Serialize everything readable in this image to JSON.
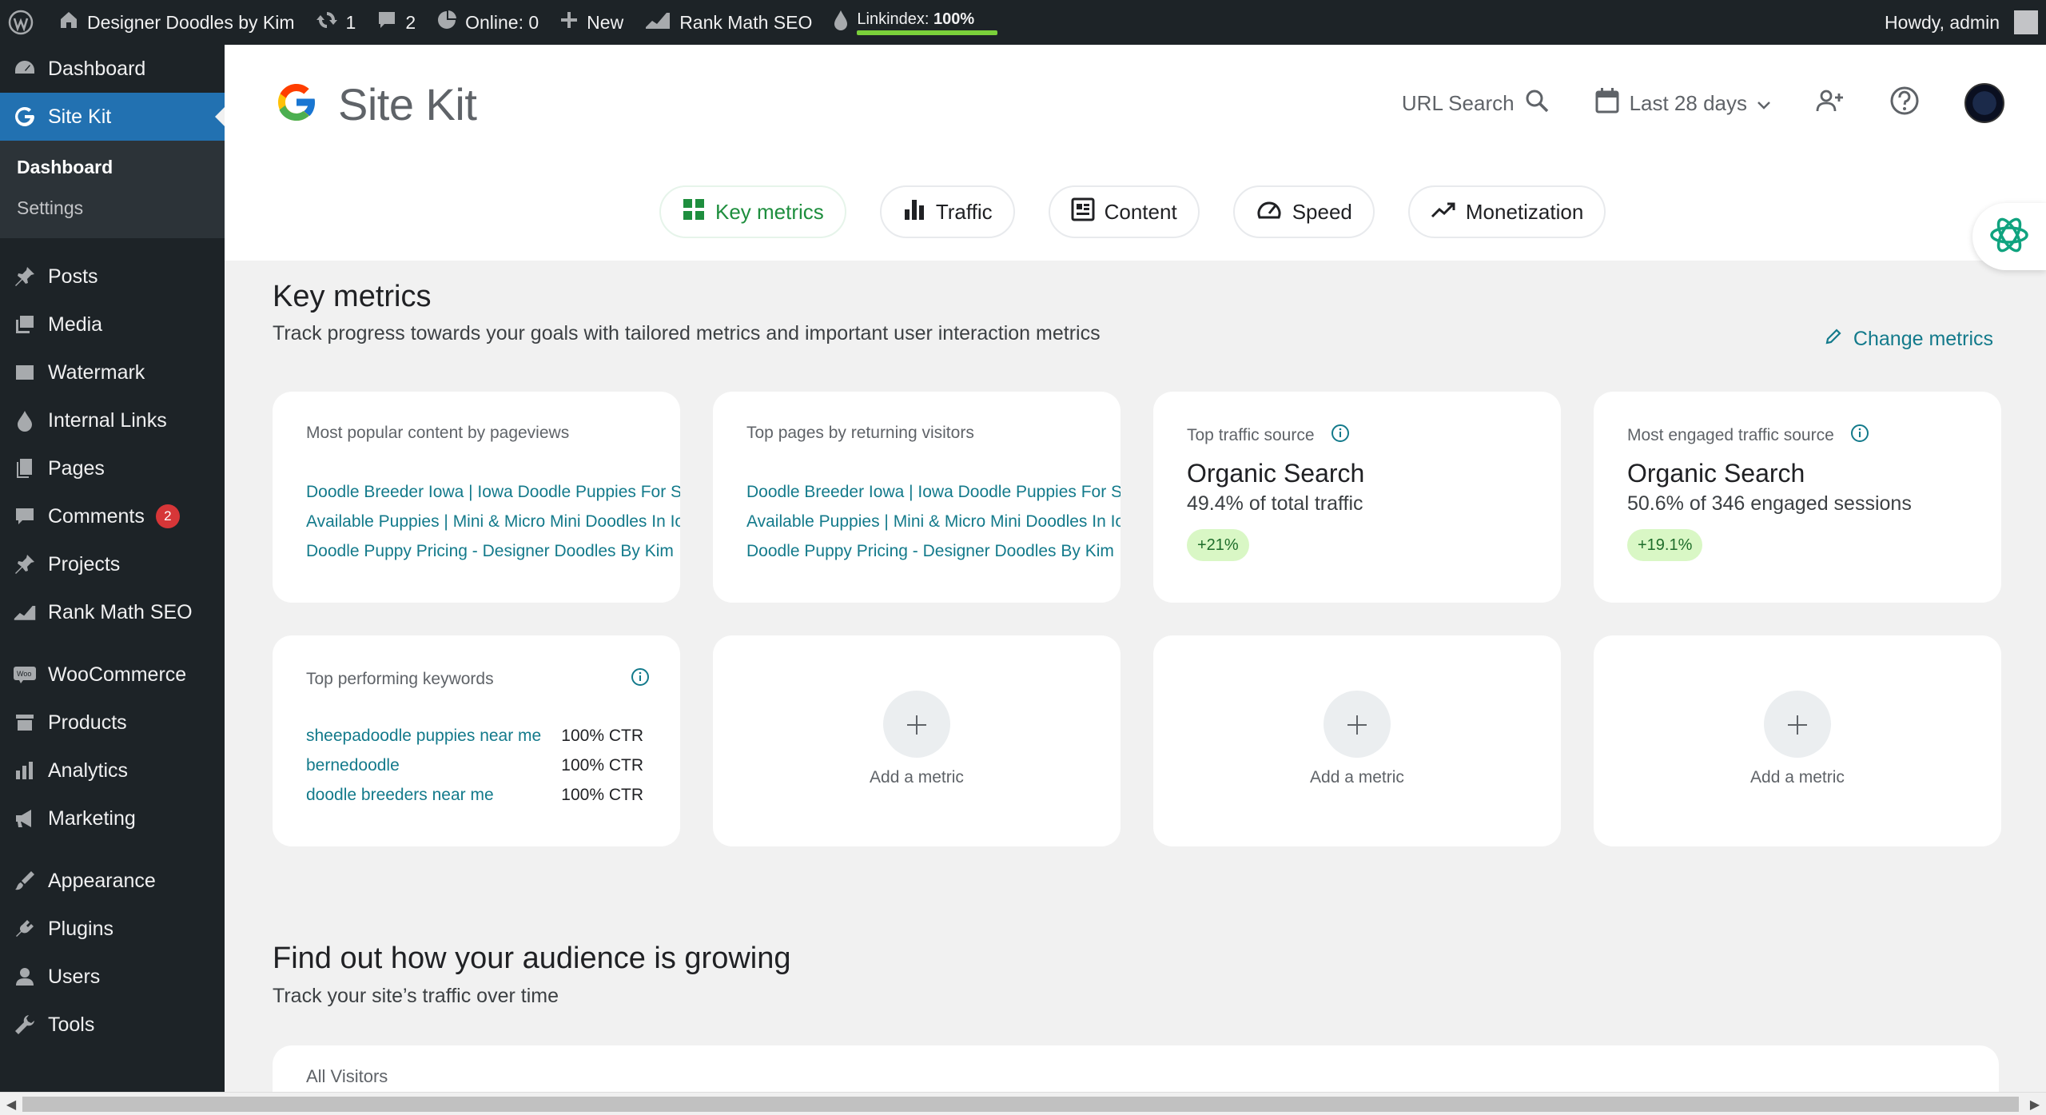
{
  "adminbar": {
    "site_name": "Designer Doodles by Kim",
    "updates_count": "1",
    "comments_count": "2",
    "online": "Online: 0",
    "new": "New",
    "rank_math": "Rank Math SEO",
    "linkindex_label": "Linkindex:",
    "linkindex_value": "100%",
    "linkindex_progress": 1.0,
    "howdy": "Howdy, admin"
  },
  "sidebar": {
    "dashboard": "Dashboard",
    "site_kit": "Site Kit",
    "sub_dashboard": "Dashboard",
    "sub_settings": "Settings",
    "posts": "Posts",
    "media": "Media",
    "watermark": "Watermark",
    "internal_links": "Internal Links",
    "pages": "Pages",
    "comments": "Comments",
    "comments_badge": "2",
    "projects": "Projects",
    "rank_math": "Rank Math SEO",
    "woocommerce": "WooCommerce",
    "products": "Products",
    "analytics": "Analytics",
    "marketing": "Marketing",
    "appearance": "Appearance",
    "plugins": "Plugins",
    "users": "Users",
    "tools": "Tools"
  },
  "header": {
    "title": "Site Kit",
    "url_search": "URL Search",
    "date_range": "Last 28 days"
  },
  "tabs": {
    "key_metrics": "Key metrics",
    "traffic": "Traffic",
    "content": "Content",
    "speed": "Speed",
    "monetization": "Monetization"
  },
  "key_metrics": {
    "title": "Key metrics",
    "description": "Track progress towards your goals with tailored metrics and important user interaction metrics",
    "change_metrics": "Change metrics",
    "popular_content": {
      "title": "Most popular content by pageviews",
      "links": [
        "Doodle Breeder Iowa | Iowa Doodle Puppies For Sale",
        "Available Puppies | Mini & Micro Mini Doodles In Iowa",
        "Doodle Puppy Pricing - Designer Doodles By Kim"
      ]
    },
    "returning_visitors": {
      "title": "Top pages by returning visitors",
      "links": [
        "Doodle Breeder Iowa | Iowa Doodle Puppies For Sale",
        "Available Puppies | Mini & Micro Mini Doodles In Iowa",
        "Doodle Puppy Pricing - Designer Doodles By Kim"
      ]
    },
    "traffic_source": {
      "title": "Top traffic source",
      "value": "Organic Search",
      "detail": "49.4% of total traffic",
      "change": "+21%"
    },
    "engaged_source": {
      "title": "Most engaged traffic source",
      "value": "Organic Search",
      "detail": "50.6% of 346 engaged sessions",
      "change": "+19.1%"
    },
    "keywords": {
      "title": "Top performing keywords",
      "rows": [
        {
          "kw": "sheepadoodle puppies near me",
          "ctr": "100% CTR"
        },
        {
          "kw": "bernedoodle",
          "ctr": "100% CTR"
        },
        {
          "kw": "doodle breeders near me",
          "ctr": "100% CTR"
        }
      ]
    },
    "add_metric": "Add a metric"
  },
  "audience": {
    "title": "Find out how your audience is growing",
    "description": "Track your site’s traffic over time",
    "card_title": "All Visitors"
  }
}
